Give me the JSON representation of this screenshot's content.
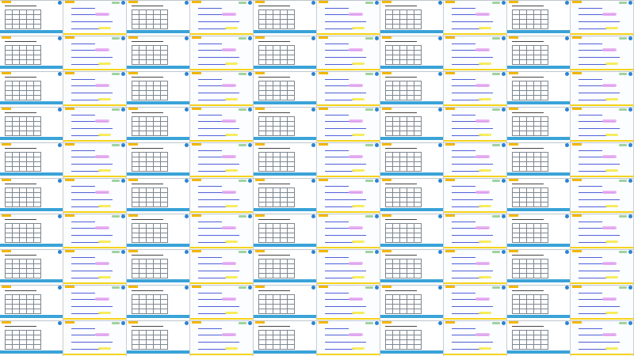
{
  "window": {
    "title": ""
  },
  "grid": {
    "columns": 10,
    "rows": 10,
    "cell_kinds": [
      [
        "table",
        "handwriting",
        "table",
        "handwriting",
        "table",
        "handwriting",
        "table",
        "handwriting",
        "table",
        "handwriting"
      ],
      [
        "table",
        "handwriting",
        "table",
        "handwriting",
        "table",
        "handwriting",
        "table",
        "handwriting",
        "table",
        "handwriting"
      ],
      [
        "table",
        "handwriting",
        "table",
        "handwriting",
        "table",
        "handwriting",
        "table",
        "handwriting",
        "table",
        "handwriting"
      ],
      [
        "table",
        "handwriting",
        "table",
        "handwriting",
        "table",
        "handwriting",
        "table",
        "handwriting",
        "table",
        "handwriting"
      ],
      [
        "table",
        "handwriting",
        "table",
        "handwriting",
        "table",
        "handwriting",
        "table",
        "handwriting",
        "table",
        "handwriting"
      ],
      [
        "table",
        "handwriting",
        "table",
        "handwriting",
        "table",
        "handwriting",
        "table",
        "handwriting",
        "table",
        "handwriting"
      ],
      [
        "table",
        "handwriting",
        "table",
        "handwriting",
        "table",
        "handwriting",
        "table",
        "handwriting",
        "table",
        "handwriting"
      ],
      [
        "table",
        "handwriting",
        "table",
        "handwriting",
        "table",
        "handwriting",
        "table",
        "handwriting",
        "table",
        "handwriting"
      ],
      [
        "table",
        "handwriting",
        "table",
        "handwriting",
        "table",
        "handwriting",
        "table",
        "handwriting",
        "table",
        "handwriting"
      ],
      [
        "table",
        "handwriting",
        "table",
        "handwriting",
        "table",
        "handwriting",
        "table",
        "handwriting",
        "table",
        "handwriting"
      ]
    ]
  },
  "colors": {
    "background": "#d8dde2",
    "page": "#ffffff",
    "accent_blue": "#2c84d3",
    "stripe_blue": "#3aa3d8",
    "badge_yellow": "#f2b705",
    "highlight_pink": "#e7a6f0",
    "highlight_yellow": "#f6ea4a",
    "ink_blue": "#5160d8"
  },
  "icons": {
    "corner": "info-dot-icon",
    "badge": "page-badge-icon"
  }
}
